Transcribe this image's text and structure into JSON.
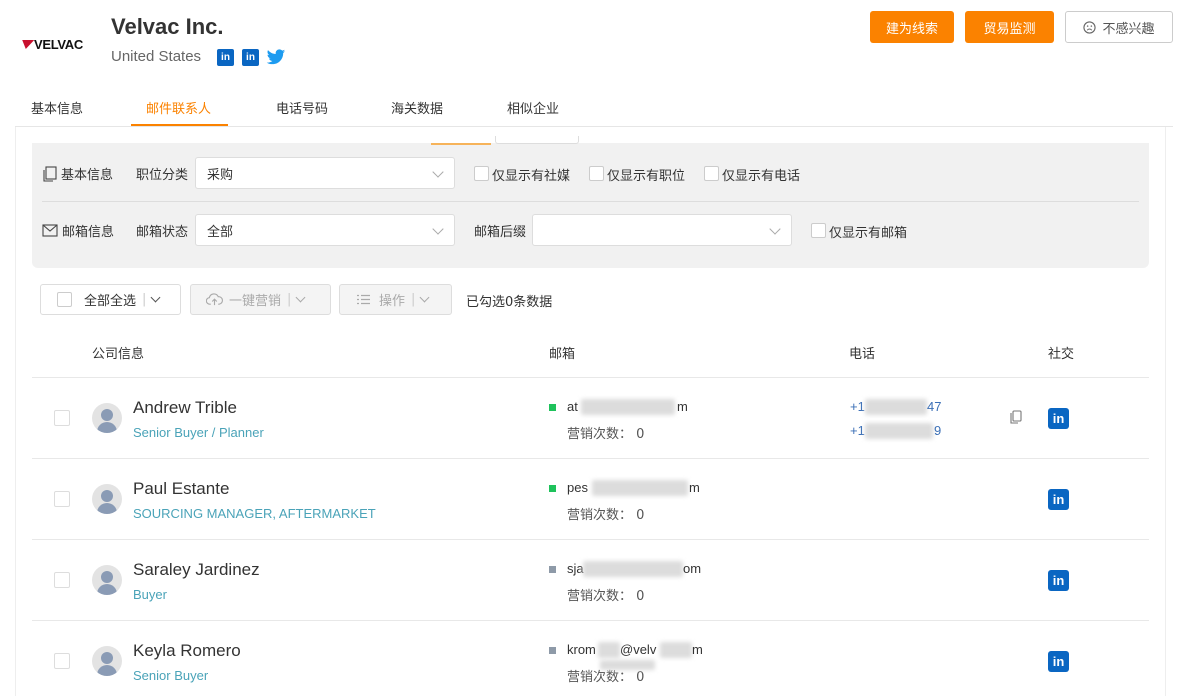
{
  "company": {
    "logo_text": "VELVAC",
    "name": "Velvac Inc.",
    "country": "United States",
    "social": [
      "linkedin-icon",
      "linkedin-icon",
      "twitter-icon"
    ]
  },
  "actions": {
    "create_lead": "建为线索",
    "trade_monitor": "贸易监测",
    "not_interested": "不感兴趣"
  },
  "tabs": [
    {
      "label": "基本信息"
    },
    {
      "label": "邮件联系人"
    },
    {
      "label": "电话号码"
    },
    {
      "label": "海关数据"
    },
    {
      "label": "相似企业"
    }
  ],
  "filters": {
    "basic_info_label": "基本信息",
    "position_label": "职位分类",
    "position_value": "采购",
    "only_social": "仅显示有社媒",
    "only_position": "仅显示有职位",
    "only_phone": "仅显示有电话",
    "email_info_label": "邮箱信息",
    "email_status_label": "邮箱状态",
    "email_status_value": "全部",
    "email_suffix_label": "邮箱后缀",
    "email_suffix_value": "",
    "only_email": "仅显示有邮箱"
  },
  "toolbar": {
    "select_all": "全部全选",
    "one_click_marketing": "一键营销",
    "operate": "操作",
    "selected_text": "已勾选0条数据"
  },
  "columns": {
    "company_info": "公司信息",
    "email": "邮箱",
    "phone": "电话",
    "social": "社交"
  },
  "contacts": [
    {
      "name": "Andrew Trible",
      "title": "Senior Buyer / Planner",
      "email_start": "at",
      "email_end": "m",
      "marketing": "营销次数：  0",
      "status": "valid",
      "phones": [
        "+1",
        "47",
        "+1",
        "9"
      ]
    },
    {
      "name": "Paul Estante",
      "title": "SOURCING MANAGER, AFTERMARKET",
      "email_start": "pes",
      "email_end": "m",
      "marketing": "营销次数：  0",
      "status": "valid"
    },
    {
      "name": "Saraley Jardinez",
      "title": "Buyer",
      "email_start": "sja",
      "email_end": "om",
      "marketing": "营销次数：  0",
      "status": "unknown"
    },
    {
      "name": "Keyla Romero",
      "title": "Senior Buyer",
      "email_start": "krom",
      "email_mid": "@velv",
      "email_end": "m",
      "marketing": "营销次数：  0",
      "status": "unknown"
    }
  ],
  "colors": {
    "accent": "#fb8200",
    "status_valid": "#1ec25b",
    "status_unknown": "#8e9aa8",
    "linkedin": "#0a66c2",
    "title_link": "#4aa3b8"
  }
}
